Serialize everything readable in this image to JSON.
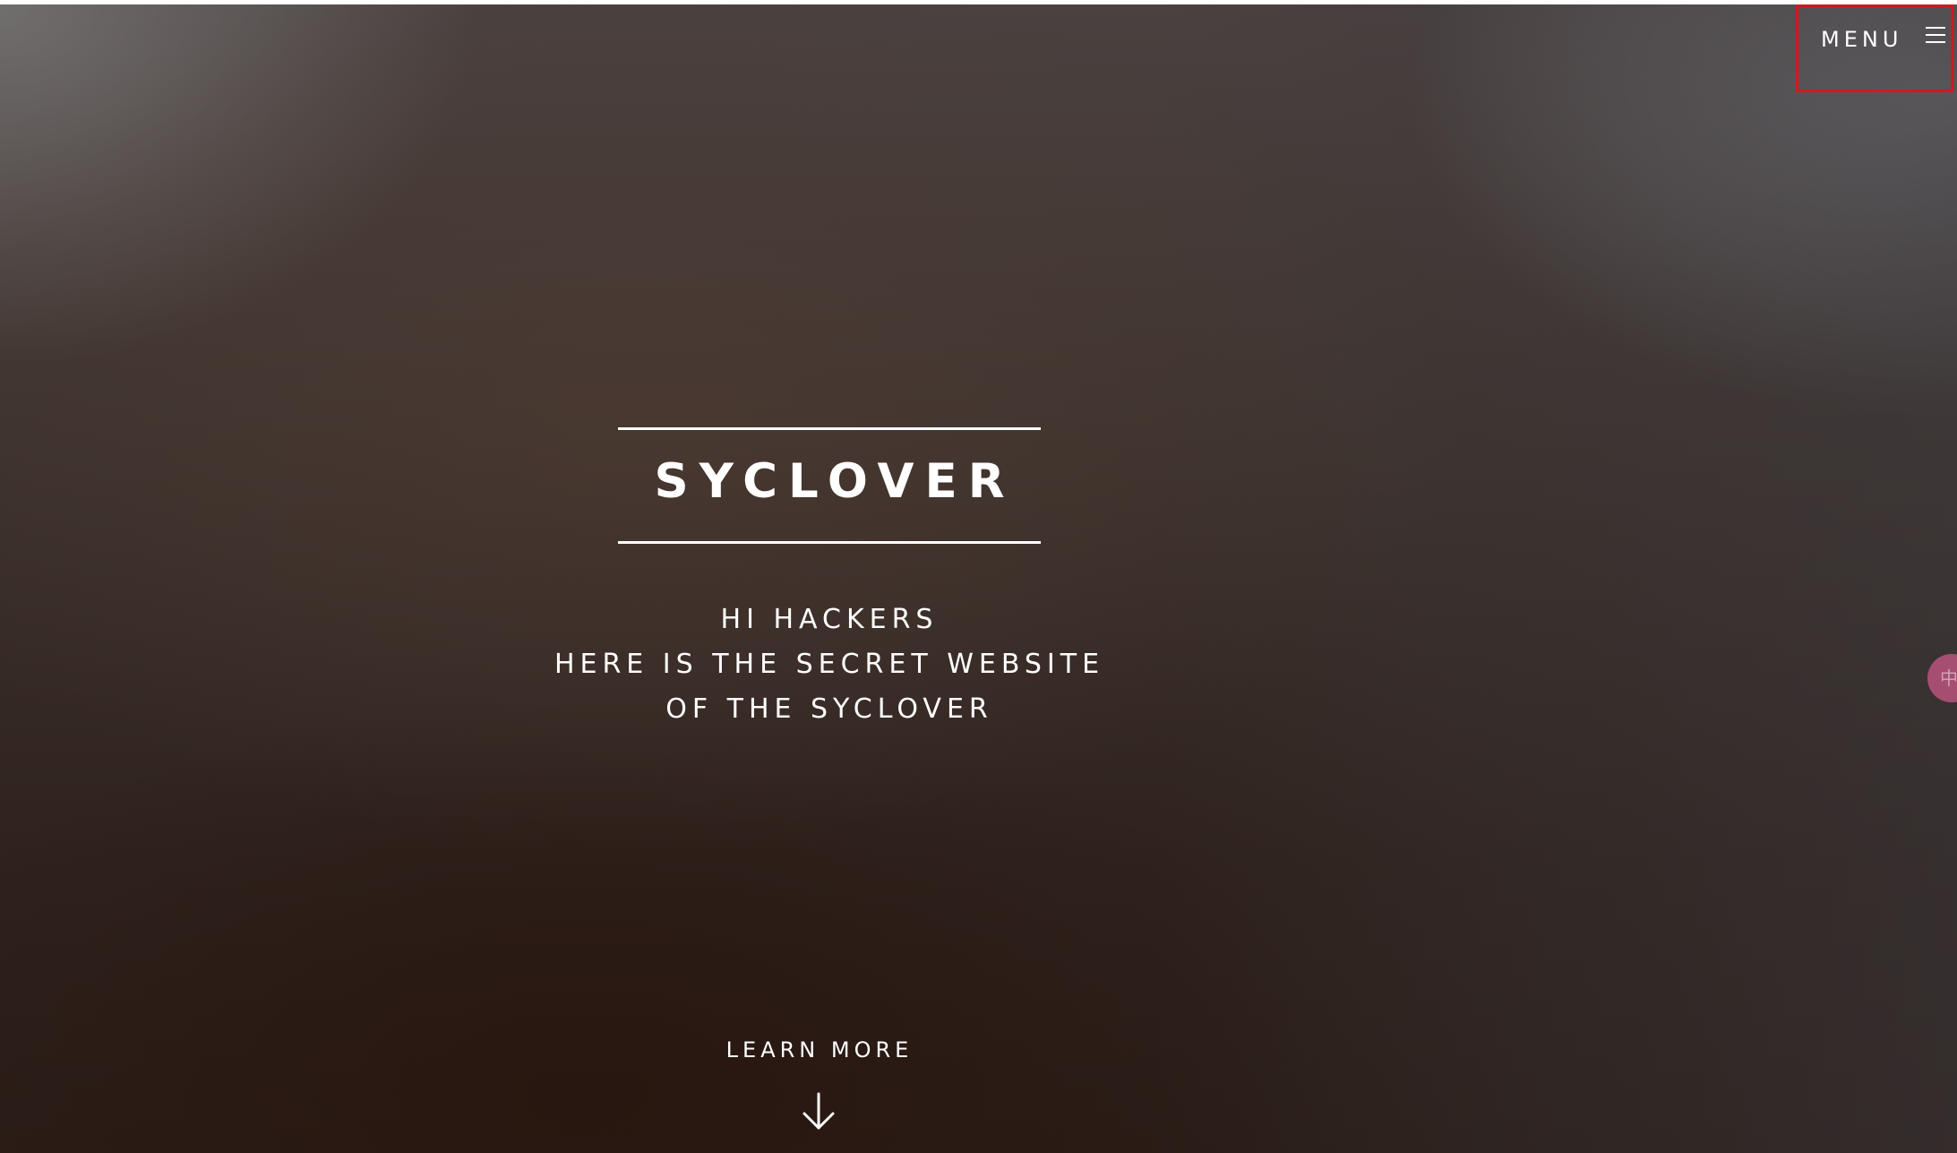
{
  "header": {
    "menu_label": "MENU",
    "menu_icon": "hamburger-icon"
  },
  "hero": {
    "brand_title": "SYCLOVER",
    "tagline_lines": [
      "HI HACKERS",
      "HERE IS THE SECRET WEBSITE",
      "OF THE SYCLOVER"
    ],
    "learn_more_label": "LEARN MORE",
    "learn_more_icon": "down-arrow-icon"
  },
  "floating_widget": {
    "label": "中",
    "icon": "language-bubble-icon"
  },
  "colors": {
    "highlight_border": "#d0191f",
    "text": "#ffffff",
    "widget": "#b9547e"
  }
}
